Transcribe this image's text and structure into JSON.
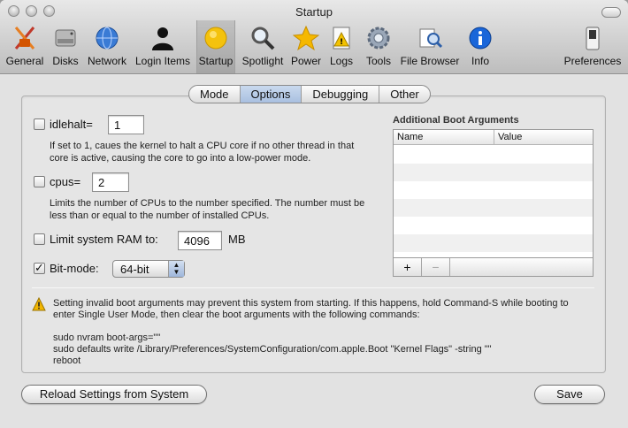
{
  "window": {
    "title": "Startup"
  },
  "toolbar": {
    "items": [
      {
        "label": "General",
        "icon": "general-icon"
      },
      {
        "label": "Disks",
        "icon": "disk-icon"
      },
      {
        "label": "Network",
        "icon": "globe-icon"
      },
      {
        "label": "Login Items",
        "icon": "person-icon"
      },
      {
        "label": "Startup",
        "icon": "startup-icon",
        "selected": true
      },
      {
        "label": "Spotlight",
        "icon": "magnifier-icon"
      },
      {
        "label": "Power",
        "icon": "star-icon"
      },
      {
        "label": "Logs",
        "icon": "logs-icon"
      },
      {
        "label": "Tools",
        "icon": "gear-icon"
      },
      {
        "label": "File Browser",
        "icon": "file-browser-icon"
      },
      {
        "label": "Info",
        "icon": "info-icon"
      }
    ],
    "preferences_label": "Preferences"
  },
  "tabs": [
    "Mode",
    "Options",
    "Debugging",
    "Other"
  ],
  "selected_tab": "Options",
  "options": {
    "idlehalt": {
      "label": "idlehalt=",
      "value": "1",
      "checked": false,
      "description": "If set to 1, caues the kernel to halt a CPU core if no other thread in that core is active, causing the core to go into a low-power mode."
    },
    "cpus": {
      "label": "cpus=",
      "value": "2",
      "checked": false,
      "description": "Limits the number of CPUs to the number specified. The number must be less than or equal to the number of installed CPUs."
    },
    "ram": {
      "label": "Limit system RAM to:",
      "value": "4096",
      "unit": "MB",
      "checked": false
    },
    "bitmode": {
      "label": "Bit-mode:",
      "value": "64-bit",
      "checked": true
    }
  },
  "boot_args": {
    "title": "Additional Boot Arguments",
    "columns": [
      "Name",
      "Value"
    ],
    "add_label": "+",
    "remove_label": "−"
  },
  "warning": {
    "text": "Setting invalid boot arguments may prevent this system from starting. If this happens, hold Command-S while booting to enter Single User Mode, then clear the boot arguments with the following commands:",
    "commands": [
      "sudo nvram boot-args=\"\"",
      "sudo defaults write /Library/Preferences/SystemConfiguration/com.apple.Boot \"Kernel Flags\" -string \"\"",
      "reboot"
    ]
  },
  "buttons": {
    "reload": "Reload Settings from System",
    "save": "Save"
  }
}
